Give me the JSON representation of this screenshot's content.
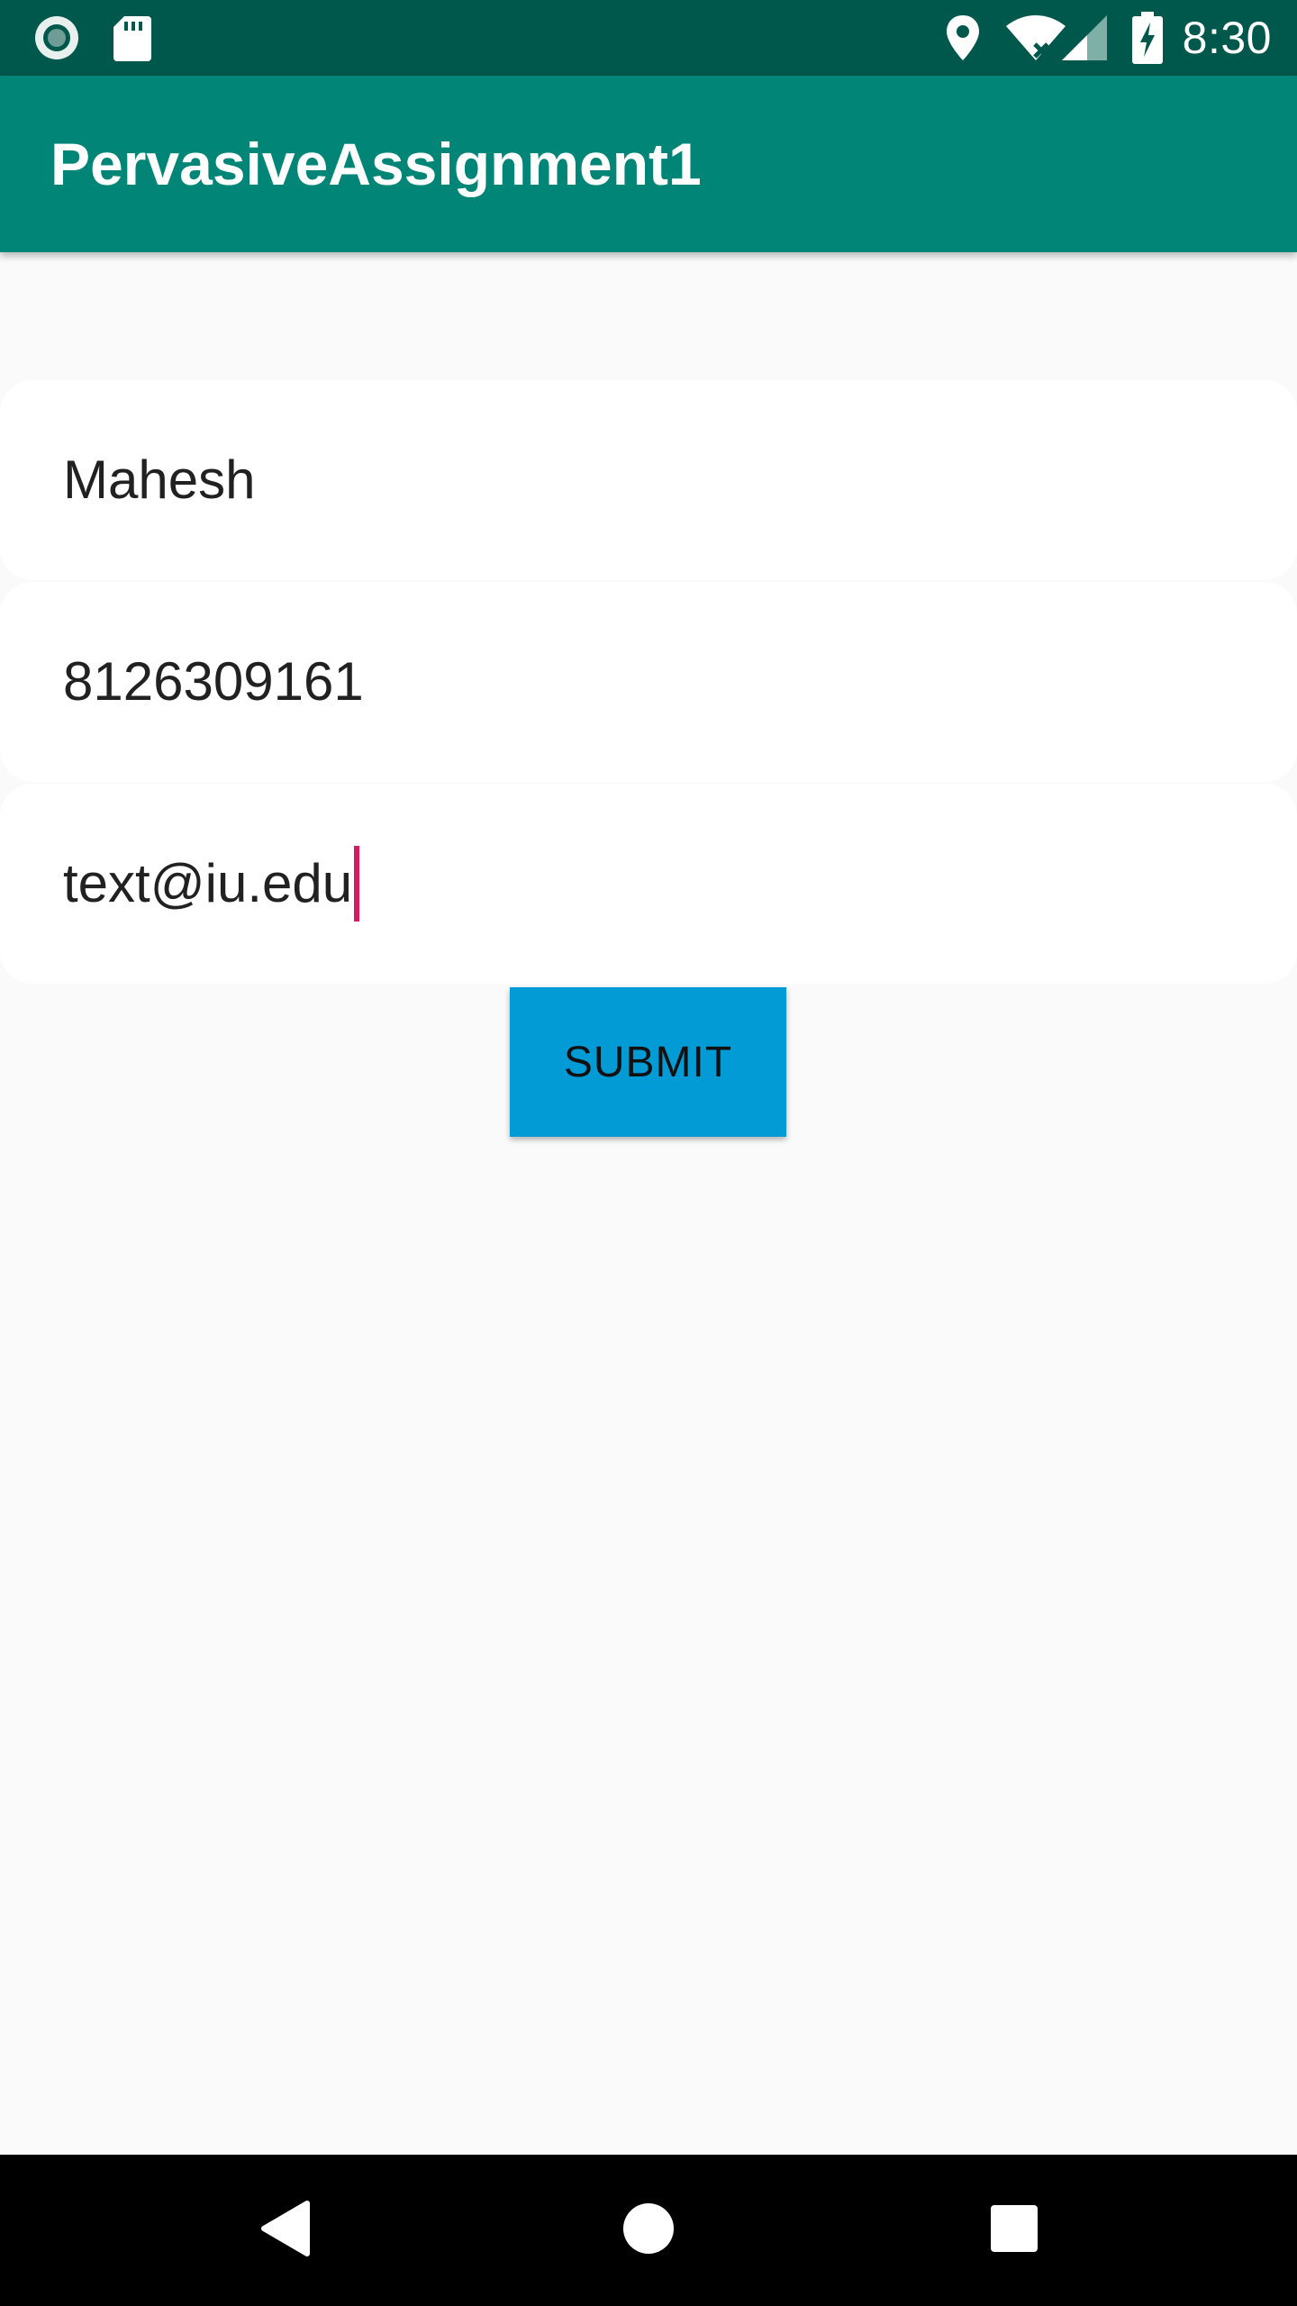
{
  "status_bar": {
    "time": "8:30",
    "left_icons": [
      "record-icon",
      "sd-card-icon"
    ],
    "right_icons": [
      "location-icon",
      "wifi-icon",
      "cell-signal-icon",
      "battery-charging-icon"
    ]
  },
  "app_bar": {
    "title": "PervasiveAssignment1"
  },
  "form": {
    "name_value": "Mahesh",
    "phone_value": "8126309161",
    "email_value": "text@iu.edu",
    "submit_label": "SUBMIT"
  },
  "nav_bar": {
    "icons": [
      "back-icon",
      "home-icon",
      "recents-icon"
    ]
  },
  "colors": {
    "status_bar": "#00574b",
    "app_bar": "#008577",
    "button": "#039bd5",
    "cursor": "#d81b60",
    "background": "#fafafa"
  }
}
